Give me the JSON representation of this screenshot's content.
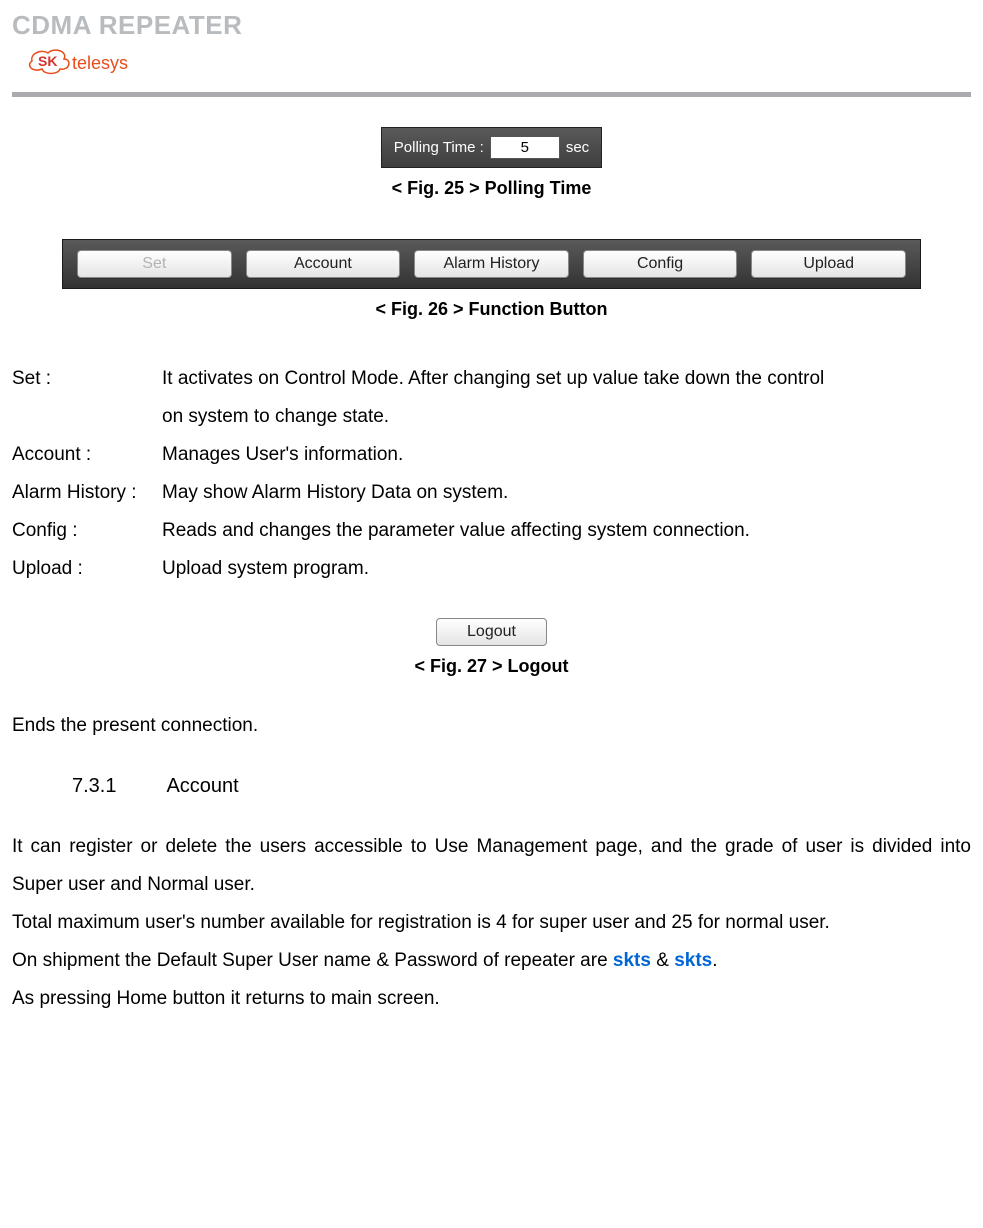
{
  "header": {
    "title": "CDMA REPEATER",
    "logo_text": "telesys",
    "logo_prefix": "SK"
  },
  "polling": {
    "label": "Polling Time :",
    "value": "5",
    "unit": "sec",
    "caption": "< Fig. 25 > Polling Time"
  },
  "buttonbar": {
    "buttons": [
      {
        "label": "Set",
        "disabled": true
      },
      {
        "label": "Account",
        "disabled": false
      },
      {
        "label": "Alarm History",
        "disabled": false
      },
      {
        "label": "Config",
        "disabled": false
      },
      {
        "label": "Upload",
        "disabled": false
      }
    ],
    "caption": "< Fig. 26 > Function Button"
  },
  "descriptions": {
    "set_term": "Set :",
    "set_text1": "It activates on Control Mode. After changing set up value take down the control",
    "set_text2": "on system to change state.",
    "account_term": "Account  :",
    "account_text": "Manages User's information.",
    "alarm_term": "Alarm History :",
    "alarm_text": "May show Alarm History Data on system.",
    "config_term": "Config :",
    "config_text": "Reads and changes the parameter value affecting system connection.",
    "upload_term": "Upload :",
    "upload_text": "Upload system program."
  },
  "logout": {
    "label": "Logout",
    "caption": "< Fig. 27 > Logout",
    "desc": "Ends the present connection."
  },
  "subsection": {
    "number": "7.3.1",
    "title": "Account"
  },
  "account_paragraph": {
    "p1": "It can register or delete the users accessible to Use Management page, and the grade of user is divided into Super user and Normal user.",
    "p2": "Total maximum user's number available for registration is 4 for super user and 25 for normal user.",
    "p3_a": "On shipment the Default Super User name & Password of repeater are ",
    "cred1": "skts",
    "amp": " & ",
    "cred2": "skts",
    "p3_b": ".",
    "p4": "As pressing Home button it returns to main screen."
  }
}
